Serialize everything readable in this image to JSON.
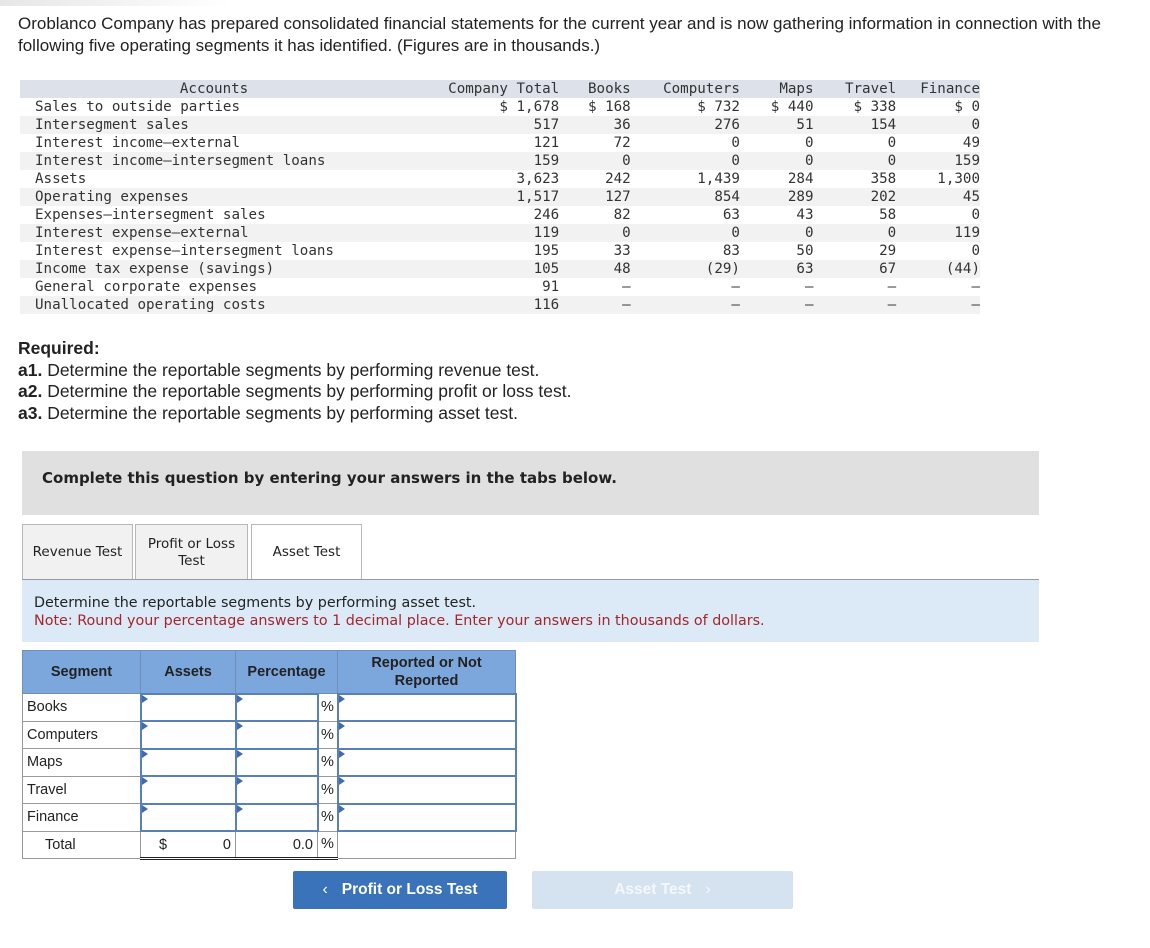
{
  "intro": "Oroblanco Company has prepared consolidated financial statements for the current year and is now gathering information in connection with the following five operating segments it has identified. (Figures are in thousands.)",
  "data_table": {
    "headers": [
      "Accounts",
      "Company Total",
      "Books",
      "Computers",
      "Maps",
      "Travel",
      "Finance"
    ],
    "rows": [
      [
        "Sales to outside parties",
        "$ 1,678",
        "$ 168",
        "$ 732",
        "$ 440",
        "$ 338",
        "$ 0"
      ],
      [
        "Intersegment sales",
        "517",
        "36",
        "276",
        "51",
        "154",
        "0"
      ],
      [
        "Interest income–external",
        "121",
        "72",
        "0",
        "0",
        "0",
        "49"
      ],
      [
        "Interest income–intersegment loans",
        "159",
        "0",
        "0",
        "0",
        "0",
        "159"
      ],
      [
        "Assets",
        "3,623",
        "242",
        "1,439",
        "284",
        "358",
        "1,300"
      ],
      [
        "Operating expenses",
        "1,517",
        "127",
        "854",
        "289",
        "202",
        "45"
      ],
      [
        "Expenses–intersegment sales",
        "246",
        "82",
        "63",
        "43",
        "58",
        "0"
      ],
      [
        "Interest expense–external",
        "119",
        "0",
        "0",
        "0",
        "0",
        "119"
      ],
      [
        "Interest expense–intersegment loans",
        "195",
        "33",
        "83",
        "50",
        "29",
        "0"
      ],
      [
        "Income tax expense (savings)",
        "105",
        "48",
        "(29)",
        "63",
        "67",
        "(44)"
      ],
      [
        "General corporate expenses",
        "91",
        "–",
        "–",
        "–",
        "–",
        "–"
      ],
      [
        "Unallocated operating costs",
        "116",
        "–",
        "–",
        "–",
        "–",
        "–"
      ]
    ]
  },
  "required": {
    "heading": "Required:",
    "items": [
      {
        "label": "a1.",
        "text": " Determine the reportable segments by performing revenue test."
      },
      {
        "label": "a2.",
        "text": " Determine the reportable segments by performing profit or loss test."
      },
      {
        "label": "a3.",
        "text": " Determine the reportable segments by performing asset test."
      }
    ]
  },
  "banner": "Complete this question by entering your answers in the tabs below.",
  "tabs": [
    {
      "label": "Revenue Test",
      "active": false
    },
    {
      "label": "Profit or Loss Test",
      "active": false
    },
    {
      "label": "Asset Test",
      "active": true
    }
  ],
  "instructions": {
    "line1": "Determine the reportable segments by performing asset test.",
    "note": "Note: Round your percentage answers to 1 decimal place. Enter your answers in thousands of dollars."
  },
  "answer_table": {
    "headers": [
      "Segment",
      "Assets",
      "Percentage",
      "Reported or Not Reported"
    ],
    "percent_symbol": "%",
    "rows": [
      {
        "segment": "Books",
        "assets": "",
        "percentage": "",
        "reported": ""
      },
      {
        "segment": "Computers",
        "assets": "",
        "percentage": "",
        "reported": ""
      },
      {
        "segment": "Maps",
        "assets": "",
        "percentage": "",
        "reported": ""
      },
      {
        "segment": "Travel",
        "assets": "",
        "percentage": "",
        "reported": ""
      },
      {
        "segment": "Finance",
        "assets": "",
        "percentage": "",
        "reported": ""
      }
    ],
    "total": {
      "label": "Total",
      "currency": "$",
      "assets": "0",
      "percentage": "0.0"
    }
  },
  "navigation": {
    "prev_label": "Profit or Loss Test",
    "next_label": "Asset Test",
    "prev_icon": "‹",
    "next_icon": "›"
  }
}
